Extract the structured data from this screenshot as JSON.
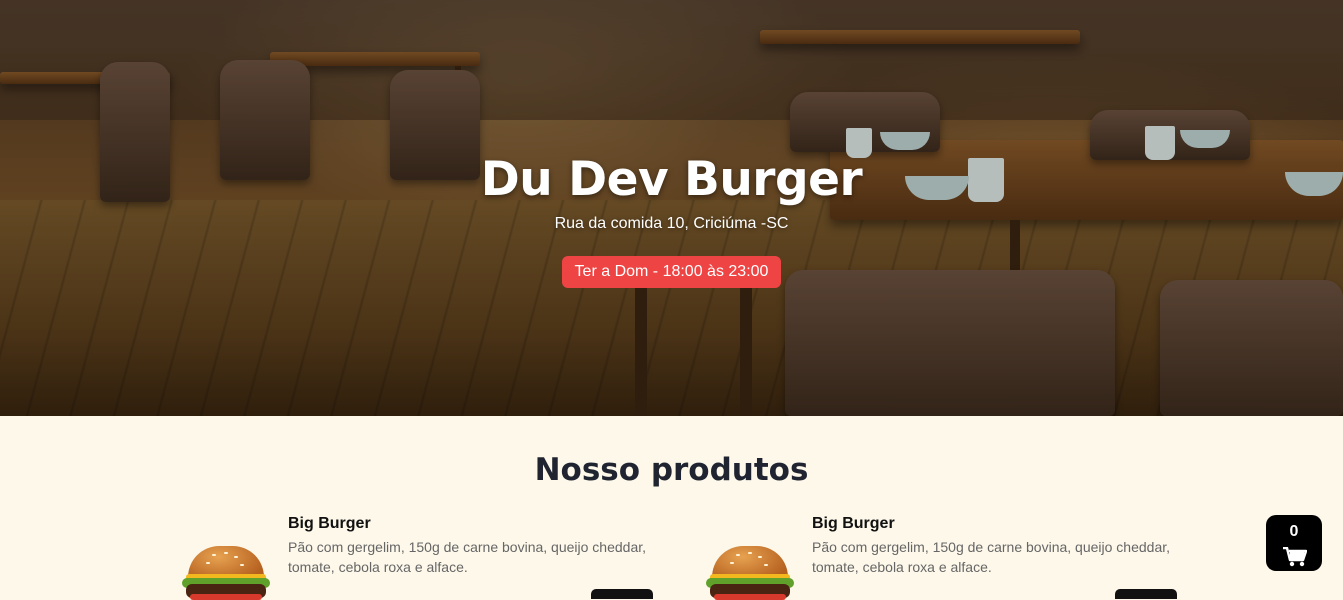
{
  "hero": {
    "title": "Du Dev Burger",
    "address": "Rua da comida 10, Criciúma -SC",
    "hours": "Ter a Dom - 18:00 às 23:00",
    "badge_color": "#ef4444"
  },
  "products_section": {
    "title": "Nosso produtos",
    "items": [
      {
        "name": "Big Burger",
        "description": "Pão com gergelim, 150g de carne bovina, queijo cheddar, tomate, cebola roxa e alface.",
        "image_icon": "burger-icon"
      },
      {
        "name": "Big Burger",
        "description": "Pão com gergelim, 150g de carne bovina, queijo cheddar, tomate, cebola roxa e alface.",
        "image_icon": "burger-icon"
      }
    ]
  },
  "cart": {
    "count": "0",
    "icon": "cart-icon"
  },
  "colors": {
    "page_background": "#fdf8ea",
    "accent": "#ef4444",
    "cart_background": "#000000"
  }
}
